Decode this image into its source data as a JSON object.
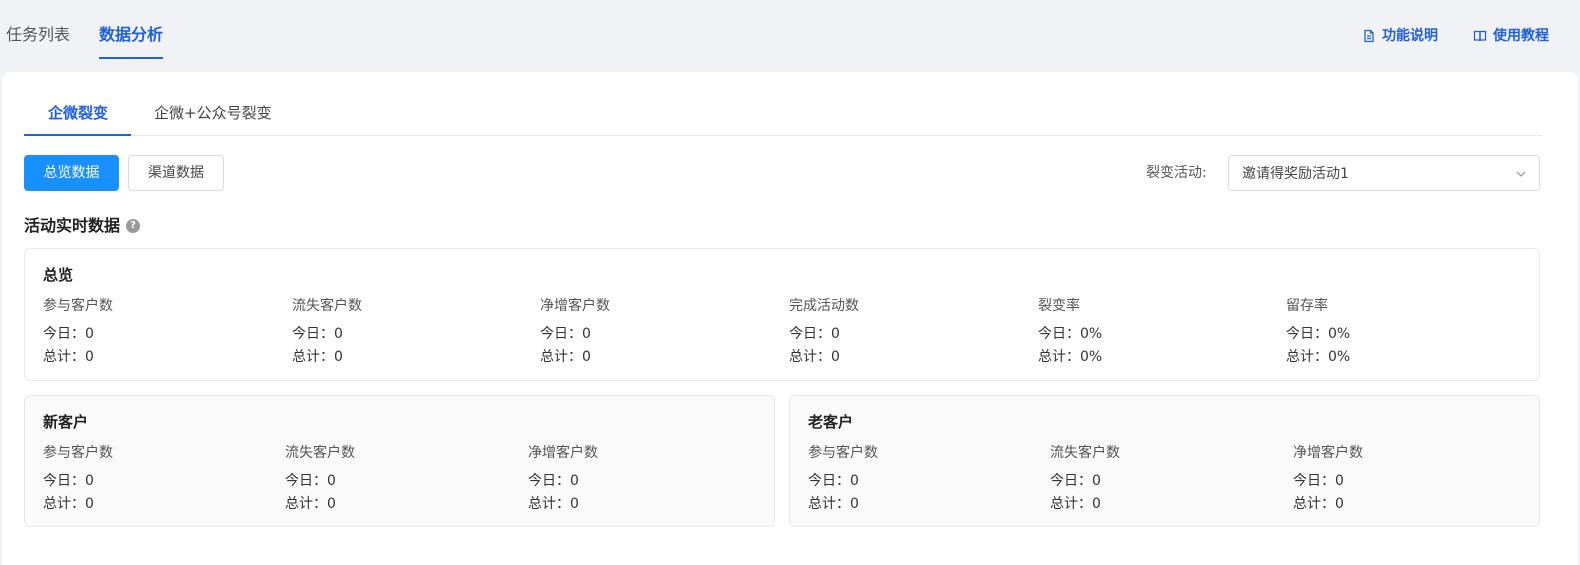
{
  "top_tabs": [
    {
      "label": "任务列表",
      "active": false
    },
    {
      "label": "数据分析",
      "active": true
    }
  ],
  "top_links": {
    "feature_description": "功能说明",
    "tutorial": "使用教程"
  },
  "sub_tabs": [
    {
      "label": "企微裂变",
      "active": true
    },
    {
      "label": "企微+公众号裂变",
      "active": false
    }
  ],
  "buttons": {
    "overview_data": "总览数据",
    "channel_data": "渠道数据"
  },
  "activity_select": {
    "label": "裂变活动:",
    "value": "邀请得奖励活动1"
  },
  "section_title": "活动实时数据",
  "overview": {
    "title": "总览",
    "metrics": [
      {
        "label": "参与客户数",
        "today": "今日：0",
        "total": "总计：0"
      },
      {
        "label": "流失客户数",
        "today": "今日：0",
        "total": "总计：0"
      },
      {
        "label": "净增客户数",
        "today": "今日：0",
        "total": "总计：0"
      },
      {
        "label": "完成活动数",
        "today": "今日：0",
        "total": "总计：0"
      },
      {
        "label": "裂变率",
        "today": "今日：0%",
        "total": "总计：0%"
      },
      {
        "label": "留存率",
        "today": "今日：0%",
        "total": "总计：0%"
      }
    ]
  },
  "new_customers": {
    "title": "新客户",
    "metrics": [
      {
        "label": "参与客户数",
        "today": "今日：0",
        "total": "总计：0"
      },
      {
        "label": "流失客户数",
        "today": "今日：0",
        "total": "总计：0"
      },
      {
        "label": "净增客户数",
        "today": "今日：0",
        "total": "总计：0"
      }
    ]
  },
  "old_customers": {
    "title": "老客户",
    "metrics": [
      {
        "label": "参与客户数",
        "today": "今日：0",
        "total": "总计：0"
      },
      {
        "label": "流失客户数",
        "today": "今日：0",
        "total": "总计：0"
      },
      {
        "label": "净增客户数",
        "today": "今日：0",
        "total": "总计：0"
      }
    ]
  },
  "colors": {
    "accent": "#1f5fe0",
    "primary_button": "#1890ff"
  }
}
